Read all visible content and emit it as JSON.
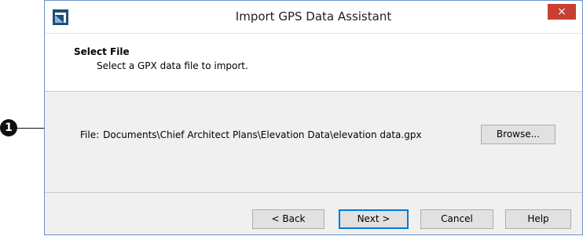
{
  "window": {
    "title": "Import GPS Data Assistant",
    "close_glyph": "×"
  },
  "header": {
    "title": "Select File",
    "subtitle": "Select a GPX data file to import."
  },
  "file": {
    "label": "File:",
    "path": "Documents\\Chief Architect Plans\\Elevation Data\\elevation data.gpx",
    "browse_label": "Browse..."
  },
  "footer": {
    "back_label": "< Back",
    "next_label": "Next >",
    "cancel_label": "Cancel",
    "help_label": "Help"
  },
  "callout": {
    "number": "1"
  },
  "icons": {
    "app": "chief-architect-logo-icon",
    "close": "close-icon"
  },
  "colors": {
    "close_button": "#c84031",
    "default_button_border": "#0078d7",
    "app_icon": "#1f4e79"
  }
}
